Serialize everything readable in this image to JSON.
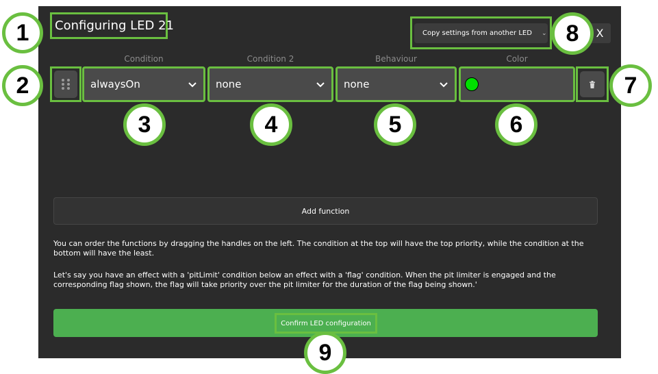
{
  "dialog": {
    "title": "Configuring LED 21",
    "copy_button_label": "Copy settings from another LED",
    "close_label": "X"
  },
  "columns": {
    "condition": "Condition",
    "condition2": "Condition 2",
    "behaviour": "Behaviour",
    "color": "Color"
  },
  "function_row": {
    "condition_value": "alwaysOn",
    "condition2_value": "none",
    "behaviour_value": "none",
    "color_value": "#00e000"
  },
  "add_function_label": "Add function",
  "help": {
    "paragraph1": "You can order the functions by dragging the handles on the left. The condition at the top will have the top priority, while the condition at the bottom will have the least.",
    "paragraph2": "Let's say you have an effect with a 'pitLimit' condition below an effect with a 'flag' condition. When the pit limiter is engaged and the corresponding flag shown, the flag will take priority over the pit limiter for the duration of the flag being shown.'"
  },
  "confirm_label": "Confirm LED configuration",
  "callouts": [
    "1",
    "2",
    "3",
    "4",
    "5",
    "6",
    "7",
    "8",
    "9"
  ],
  "colors": {
    "highlight": "#6abf40",
    "accent_green": "#4caf50",
    "dialog_bg": "#2b2b2b"
  }
}
